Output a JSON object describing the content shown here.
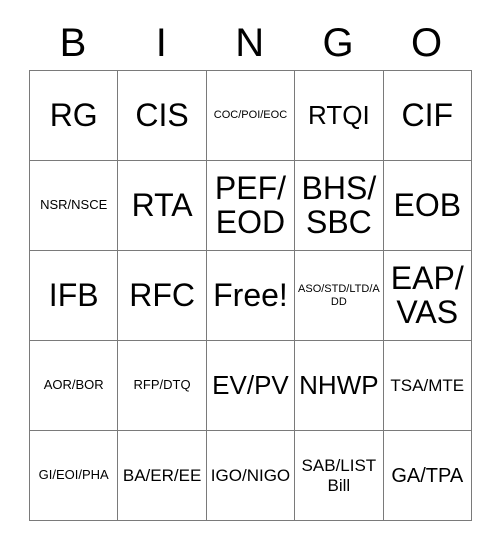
{
  "card": {
    "header_letters": [
      "B",
      "I",
      "N",
      "G",
      "O"
    ],
    "rows": [
      [
        {
          "text": "RG",
          "size": "fs-xl"
        },
        {
          "text": "CIS",
          "size": "fs-xl"
        },
        {
          "text": "COC/POI/EOC",
          "size": "fs-xxs"
        },
        {
          "text": "RTQI",
          "size": "fs-l"
        },
        {
          "text": "CIF",
          "size": "fs-xl"
        }
      ],
      [
        {
          "text": "NSR/NSCE",
          "size": "fs-xs"
        },
        {
          "text": "RTA",
          "size": "fs-xl"
        },
        {
          "text": "PEF/EOD",
          "size": "fs-xl"
        },
        {
          "text": "BHS/SBC",
          "size": "fs-xl"
        },
        {
          "text": "EOB",
          "size": "fs-xl"
        }
      ],
      [
        {
          "text": "IFB",
          "size": "fs-xl"
        },
        {
          "text": "RFC",
          "size": "fs-xl"
        },
        {
          "text": "Free!",
          "size": "fs-xl"
        },
        {
          "text": "ASO/STD/LTD/ADD",
          "size": "fs-xxs"
        },
        {
          "text": "EAP/VAS",
          "size": "fs-xl"
        }
      ],
      [
        {
          "text": "AOR/BOR",
          "size": "fs-xs"
        },
        {
          "text": "RFP/DTQ",
          "size": "fs-xs"
        },
        {
          "text": "EV/PV",
          "size": "fs-l"
        },
        {
          "text": "NHWP",
          "size": "fs-l"
        },
        {
          "text": "TSA/MTE",
          "size": "fs-s"
        }
      ],
      [
        {
          "text": "GI/EOI/PHA",
          "size": "fs-xs"
        },
        {
          "text": "BA/ER/EE",
          "size": "fs-s"
        },
        {
          "text": "IGO/NIGO",
          "size": "fs-s"
        },
        {
          "text": "SAB/LIST Bill",
          "size": "fs-s"
        },
        {
          "text": "GA/TPA",
          "size": "fs-m"
        }
      ]
    ],
    "free_space": {
      "row": 2,
      "col": 2,
      "label": "Free!"
    },
    "colors": {
      "background": "#ffffff",
      "text": "#000000",
      "border": "#7a7a7a"
    }
  }
}
